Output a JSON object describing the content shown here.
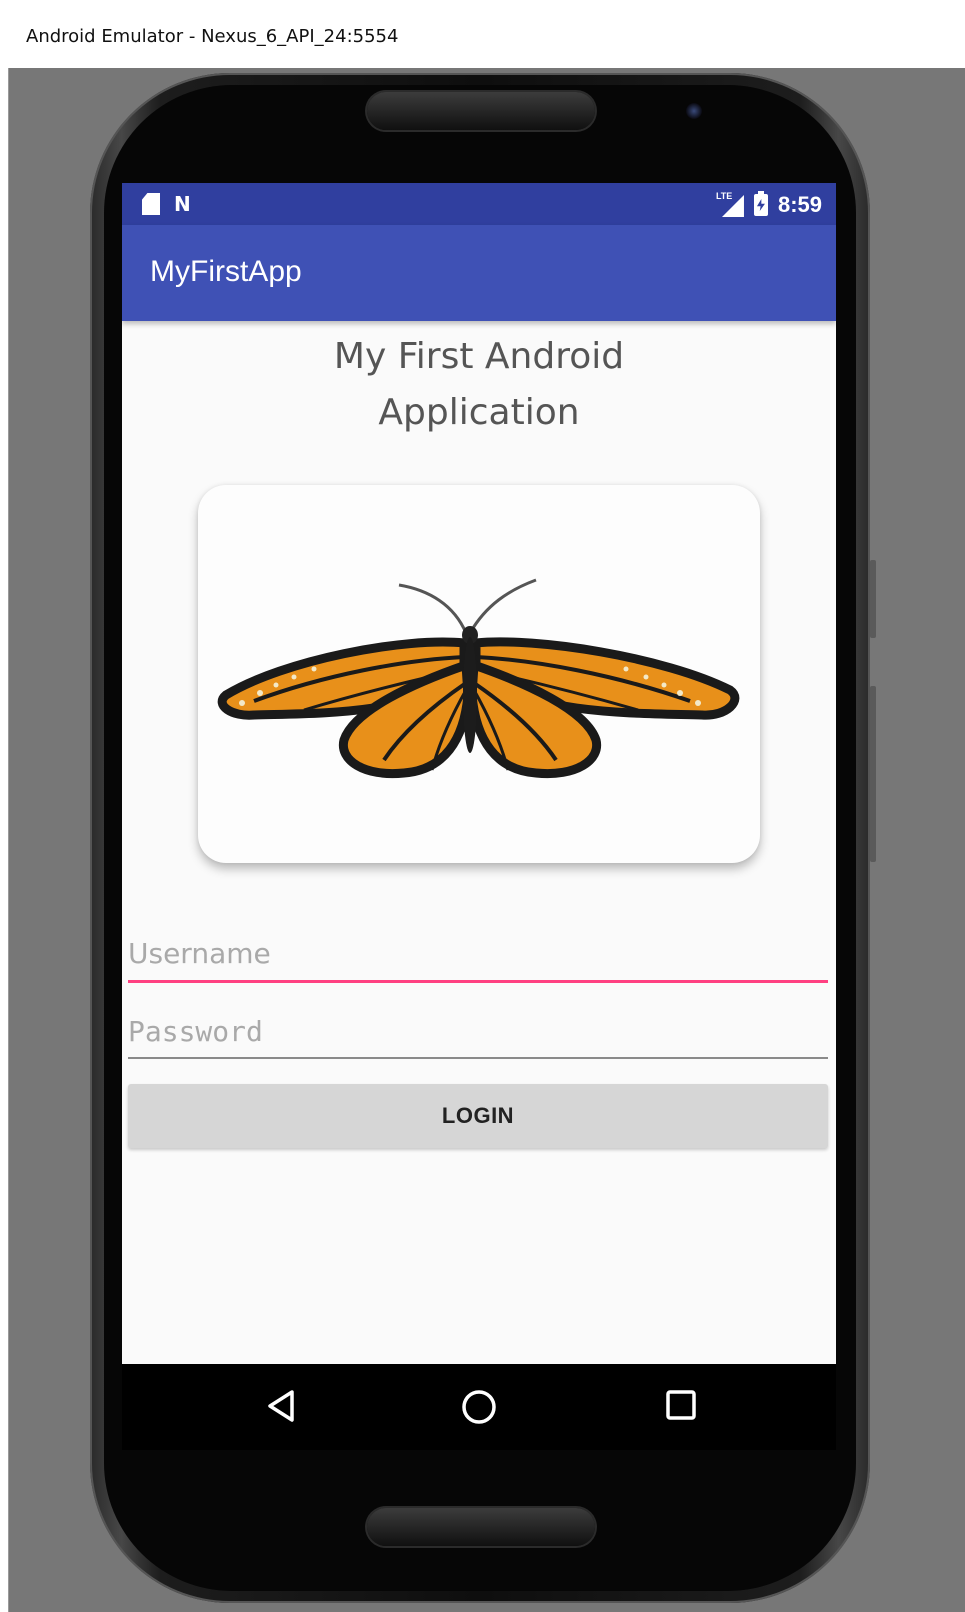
{
  "window": {
    "title": "Android Emulator - Nexus_6_API_24:5554"
  },
  "status_bar": {
    "time": "8:59",
    "network_label": "LTE",
    "icons": [
      "sd-card-icon",
      "n-notification-icon",
      "lte-signal-icon",
      "battery-charging-icon"
    ]
  },
  "app_bar": {
    "title": "MyFirstApp"
  },
  "main": {
    "heading_line1": "My First Android",
    "heading_line2": "Application",
    "image": "monarch-butterfly",
    "username_placeholder": "Username",
    "password_placeholder": "Password",
    "login_label": "LOGIN"
  },
  "nav_bar": {
    "icons": [
      "back-icon",
      "home-icon",
      "recents-icon"
    ]
  },
  "colors": {
    "status_bar": "#303f9f",
    "app_bar": "#3f51b5",
    "accent": "#ff4081",
    "button": "#d6d6d6"
  }
}
